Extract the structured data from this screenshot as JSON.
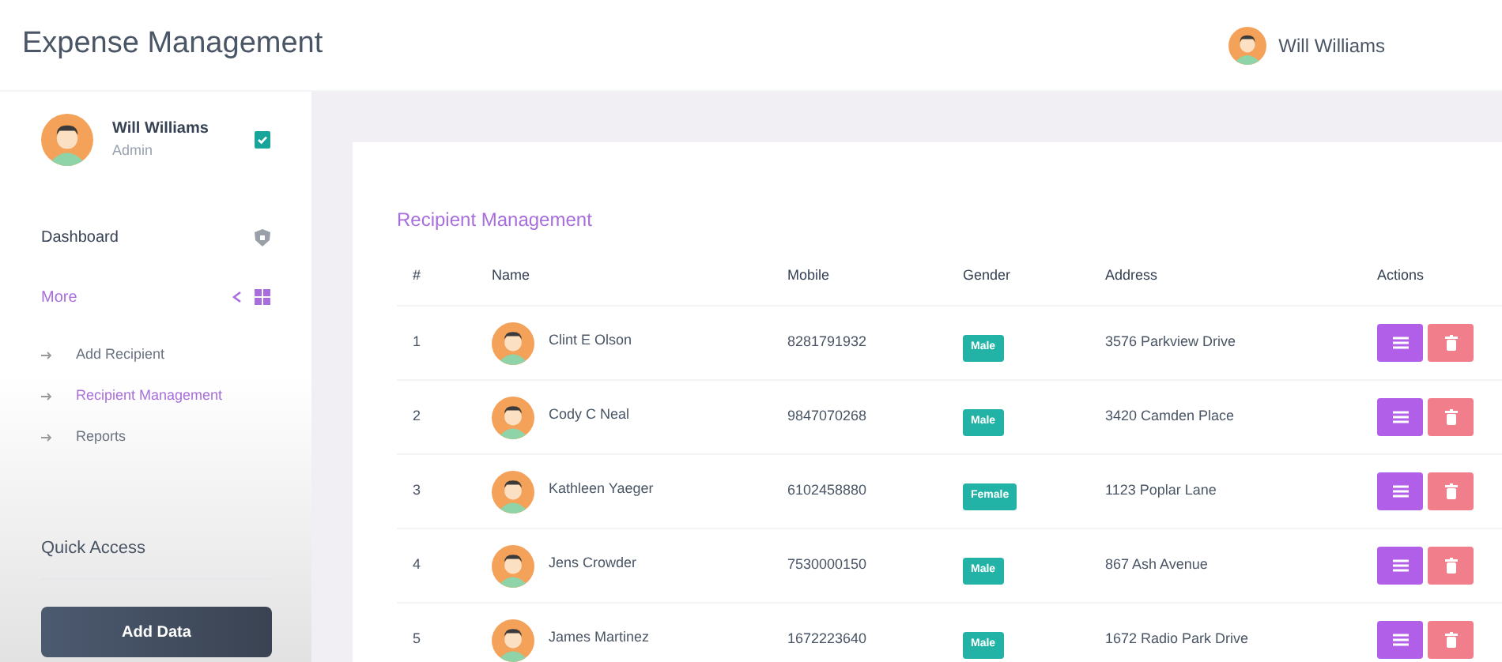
{
  "app": {
    "title": "Expense Management"
  },
  "header_user": {
    "name": "Will Williams"
  },
  "sidebar": {
    "user": {
      "name": "Will Williams",
      "role": "Admin"
    },
    "items": [
      {
        "label": "Dashboard",
        "kind": "link",
        "selected": false
      },
      {
        "label": "More",
        "kind": "group",
        "selected": true,
        "expanded": true,
        "children": [
          {
            "label": "Add Recipient",
            "selected": false
          },
          {
            "label": "Recipient Management",
            "selected": true
          },
          {
            "label": "Reports",
            "selected": false
          }
        ]
      }
    ],
    "quick_access": {
      "title": "Quick Access",
      "button": "Add Data"
    }
  },
  "card": {
    "title": "Recipient Management",
    "table": {
      "columns": [
        "#",
        "Name",
        "Mobile",
        "Gender",
        "Address",
        "Actions"
      ],
      "rows": [
        {
          "index": "1",
          "name": "Clint E Olson",
          "mobile": "8281791932",
          "gender": "Male",
          "address": "3576 Parkview Drive"
        },
        {
          "index": "2",
          "name": "Cody C Neal",
          "mobile": "9847070268",
          "gender": "Male",
          "address": "3420 Camden Place"
        },
        {
          "index": "3",
          "name": "Kathleen Yaeger",
          "mobile": "6102458880",
          "gender": "Female",
          "address": "1123 Poplar Lane"
        },
        {
          "index": "4",
          "name": "Jens Crowder",
          "mobile": "7530000150",
          "gender": "Male",
          "address": "867 Ash Avenue"
        },
        {
          "index": "5",
          "name": "James Martinez",
          "mobile": "1672223640",
          "gender": "Male",
          "address": "1672 Radio Park Drive"
        }
      ]
    }
  }
}
